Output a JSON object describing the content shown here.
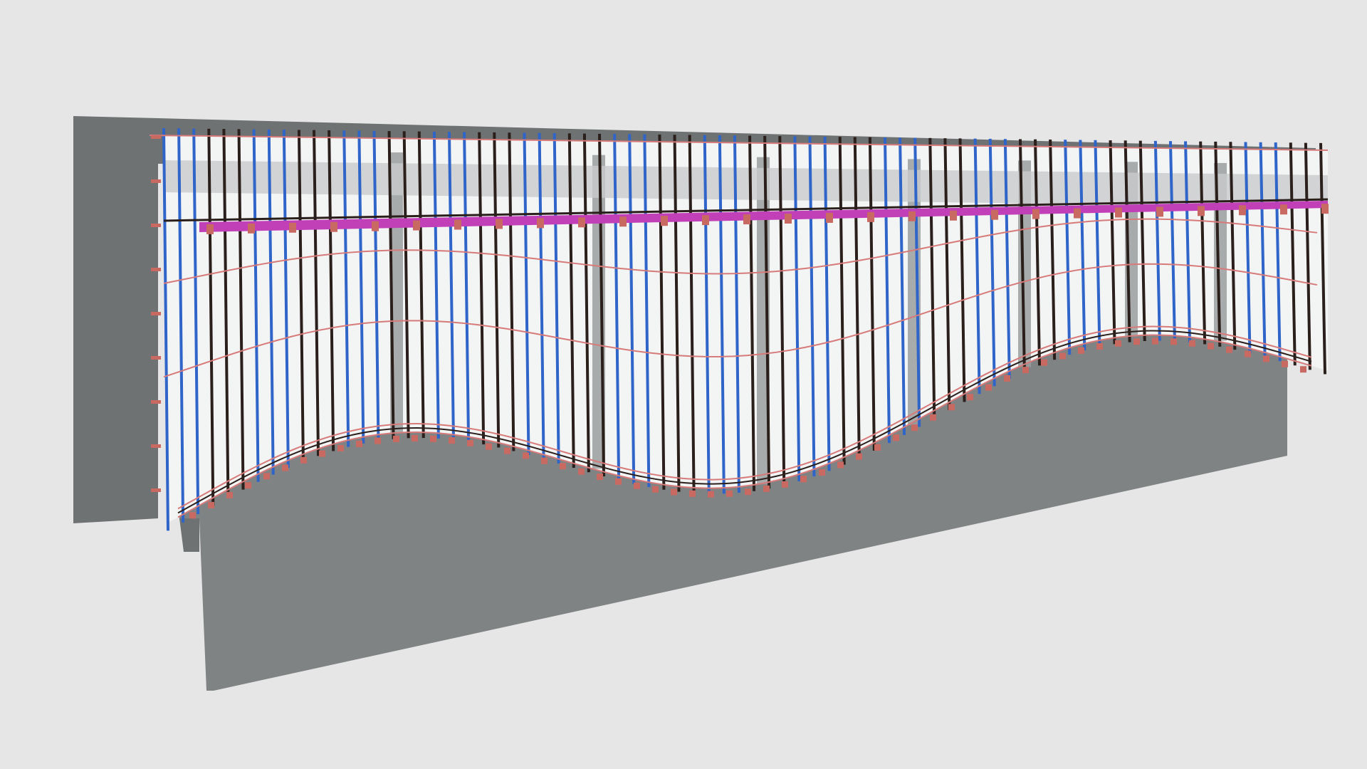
{
  "viewer": {
    "background": "#e6e6e6"
  },
  "model": {
    "concrete_wall": "#808384",
    "concrete_wall_dark": "#6f7273",
    "interior_back": "#f3f4f4",
    "column_face": "#9a9d9e",
    "mullion_blue": "#2f64c8",
    "mullion_dark": "#2b1f1c",
    "transom_red": "#d77a7a",
    "bracket_red": "#c96a62",
    "beam_magenta": "#c13fb7"
  }
}
